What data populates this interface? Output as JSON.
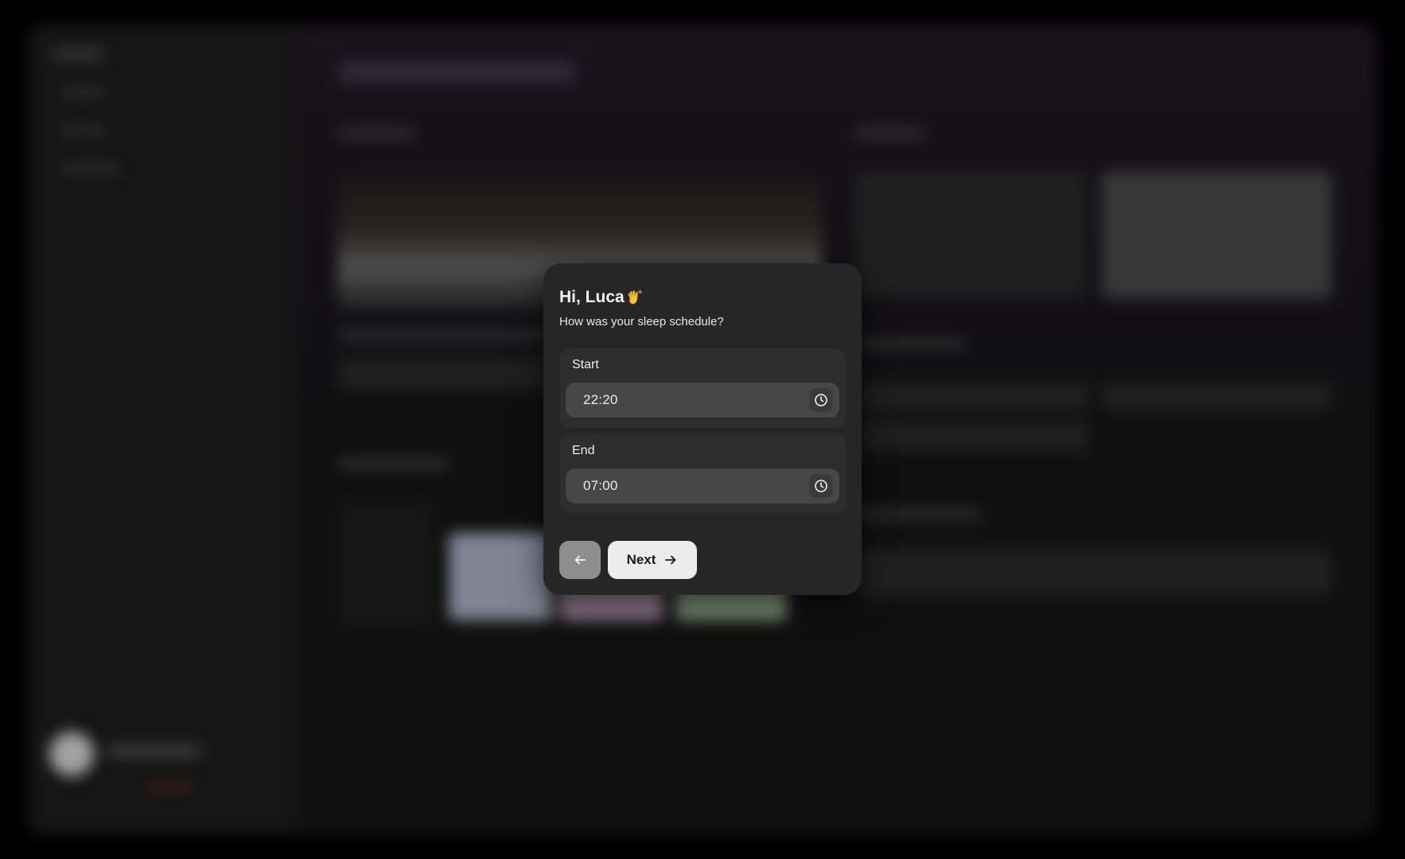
{
  "modal": {
    "greeting": "Hi, Luca",
    "greeting_emoji": "waving-hand",
    "question": "How was your sleep schedule?",
    "fields": [
      {
        "label": "Start",
        "value": "22:20",
        "icon": "clock-icon"
      },
      {
        "label": "End",
        "value": "07:00",
        "icon": "clock-icon"
      }
    ],
    "back_icon": "arrow-left-icon",
    "next_label": "Next",
    "next_icon": "arrow-right-icon"
  },
  "colors": {
    "modal_bg": "#262626",
    "field_card_bg": "#2d2d2d",
    "input_bg": "#474747",
    "back_button_bg": "#8e8e8e",
    "next_button_bg": "#ececec"
  }
}
